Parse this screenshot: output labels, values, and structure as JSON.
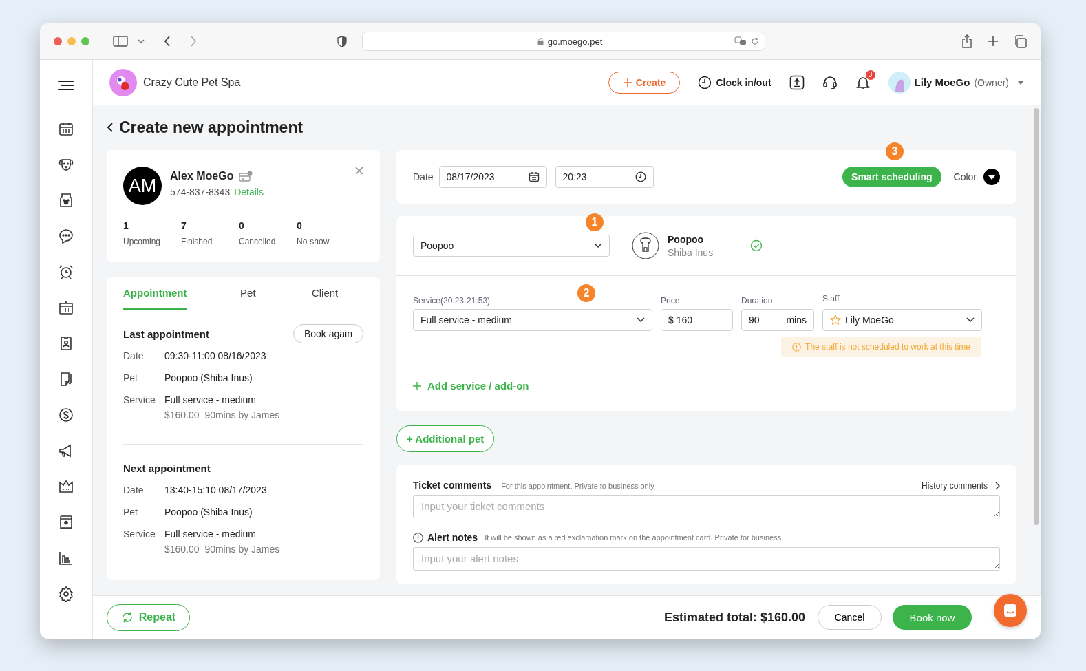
{
  "browser": {
    "url": "go.moego.pet"
  },
  "header": {
    "business_name": "Crazy Cute Pet Spa",
    "create_button": "Create",
    "clock_button": "Clock in/out",
    "notification_count": "3",
    "user_name": "Lily MoeGo",
    "user_role": "(Owner)"
  },
  "page_title": "Create new appointment",
  "client": {
    "initials": "AM",
    "name": "Alex MoeGo",
    "phone": "574-837-8343",
    "details_link": "Details",
    "stats": [
      {
        "value": "1",
        "label": "Upcoming"
      },
      {
        "value": "7",
        "label": "Finished"
      },
      {
        "value": "0",
        "label": "Cancelled"
      },
      {
        "value": "0",
        "label": "No-show"
      }
    ]
  },
  "tabs": [
    {
      "label": "Appointment",
      "selected": true
    },
    {
      "label": "Pet",
      "selected": false
    },
    {
      "label": "Client",
      "selected": false
    }
  ],
  "appointments": [
    {
      "title": "Last appointment",
      "button": "Book again",
      "rows": [
        {
          "label": "Date",
          "value": "09:30-11:00 08/16/2023"
        },
        {
          "label": "Pet",
          "value": "Poopoo (Shiba Inus)"
        },
        {
          "label": "Service",
          "value": "Full service - medium",
          "detail": "$160.00  90mins by James"
        }
      ]
    },
    {
      "title": "Next appointment",
      "rows": [
        {
          "label": "Date",
          "value": "13:40-15:10 08/17/2023"
        },
        {
          "label": "Pet",
          "value": "Poopoo (Shiba Inus)"
        },
        {
          "label": "Service",
          "value": "Full service - medium",
          "detail": "$160.00  90mins by James"
        }
      ]
    }
  ],
  "schedule": {
    "date_label": "Date",
    "date": "08/17/2023",
    "time": "20:23",
    "smart_button": "Smart scheduling",
    "step": "3",
    "color_label": "Color"
  },
  "pet": {
    "selected": "Poopoo",
    "step": "1",
    "name": "Poopoo",
    "breed": "Shiba Inus",
    "verified": true
  },
  "service": {
    "label": "Service(20:23-21:53)",
    "step": "2",
    "value": "Full service - medium",
    "price_label": "Price",
    "price": "$ 160",
    "duration_label": "Duration",
    "duration": "90",
    "duration_unit": "mins",
    "staff_label": "Staff",
    "staff": "Lily MoeGo",
    "warning": "The staff is not scheduled to work at this time"
  },
  "add_service": "Add service / add-on",
  "additional_pet": "+ Additional pet",
  "comments": {
    "ticket_title": "Ticket comments",
    "ticket_hint": "For this appointment. Private to business only",
    "history_link": "History comments",
    "ticket_placeholder": "Input your ticket comments",
    "alert_title": "Alert notes",
    "alert_hint": "It will be shown as a red exclamation mark on the appointment card. Private for business.",
    "alert_placeholder": "Input your alert notes"
  },
  "footer": {
    "repeat": "Repeat",
    "total": "Estimated total: $160.00",
    "cancel": "Cancel",
    "book": "Book now"
  }
}
